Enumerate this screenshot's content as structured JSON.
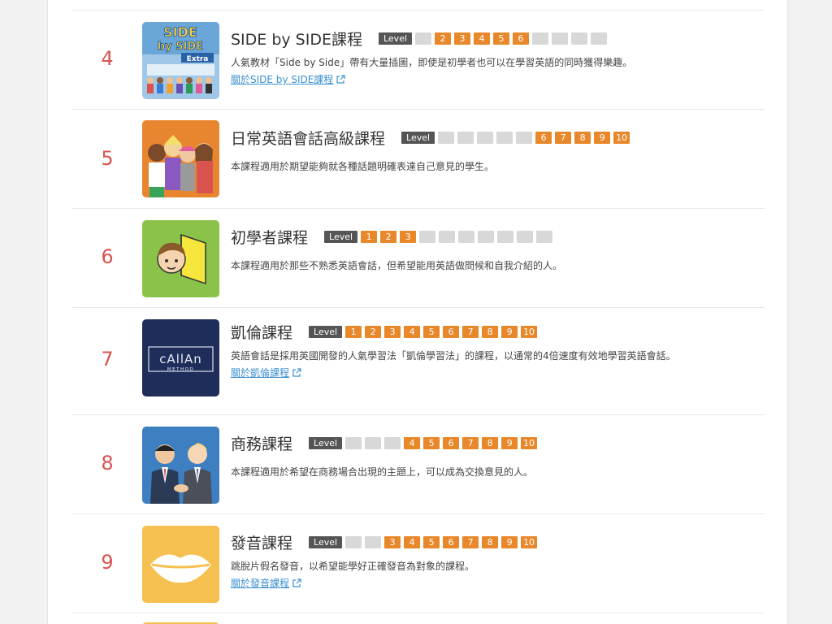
{
  "colors": {
    "number": "#d9534f",
    "level_on": "#e8882b",
    "level_off": "#d8d8d8",
    "level_tag": "#555555",
    "link": "#3a8fd0"
  },
  "courses": [
    {
      "number": "4",
      "title": "SIDE by SIDE課程",
      "level_label": "Level",
      "levels": [
        "",
        "2",
        "3",
        "4",
        "5",
        "6",
        "",
        "",
        "",
        ""
      ],
      "description": "人氣教材「Side by Side」帶有大量插圖，即使是初學者也可以在學習英語的同時獲得樂趣。",
      "link": "關於SIDE by SIDE課程",
      "thumb_icon": "side-by-side-book-cover",
      "thumb_text": {
        "line1": "SIDE",
        "line2": "by SIDE",
        "line3": "Extra"
      }
    },
    {
      "number": "5",
      "title": "日常英語會話高級課程",
      "level_label": "Level",
      "levels": [
        "",
        "",
        "",
        "",
        "",
        "6",
        "7",
        "8",
        "9",
        "10"
      ],
      "description": "本課程適用於期望能夠就各種話題明確表達自己意見的學生。",
      "link": "",
      "thumb_icon": "group-conversation-illustration"
    },
    {
      "number": "6",
      "title": "初學者課程",
      "level_label": "Level",
      "levels": [
        "1",
        "2",
        "3",
        "",
        "",
        "",
        "",
        "",
        "",
        ""
      ],
      "description": "本課程適用於那些不熟悉英語會話，但希望能用英語做問候和自我介紹的人。",
      "link": "",
      "thumb_icon": "beginner-mark-illustration"
    },
    {
      "number": "7",
      "title": "凱倫課程",
      "level_label": "Level",
      "levels": [
        "1",
        "2",
        "3",
        "4",
        "5",
        "6",
        "7",
        "8",
        "9",
        "10"
      ],
      "description": "英語會話是採用英國開發的人氣學習法「凱倫學習法」的課程，以通常的4倍速度有效地學習英語會話。",
      "link": "關於凱倫課程",
      "thumb_icon": "callan-method-logo",
      "thumb_text": {
        "line1": "cAllAn",
        "line2": "METHOD"
      }
    },
    {
      "number": "8",
      "title": "商務課程",
      "level_label": "Level",
      "levels": [
        "",
        "",
        "",
        "4",
        "5",
        "6",
        "7",
        "8",
        "9",
        "10"
      ],
      "description": "本課程適用於希望在商務場合出現的主題上，可以成為交換意見的人。",
      "link": "",
      "thumb_icon": "business-handshake-illustration"
    },
    {
      "number": "9",
      "title": "發音課程",
      "level_label": "Level",
      "levels": [
        "",
        "",
        "3",
        "4",
        "5",
        "6",
        "7",
        "8",
        "9",
        "10"
      ],
      "description": "跳脫片假名發音，以希望能學好正確發音為對象的課程。",
      "link": "關於發音課程",
      "thumb_icon": "lips-illustration"
    }
  ]
}
